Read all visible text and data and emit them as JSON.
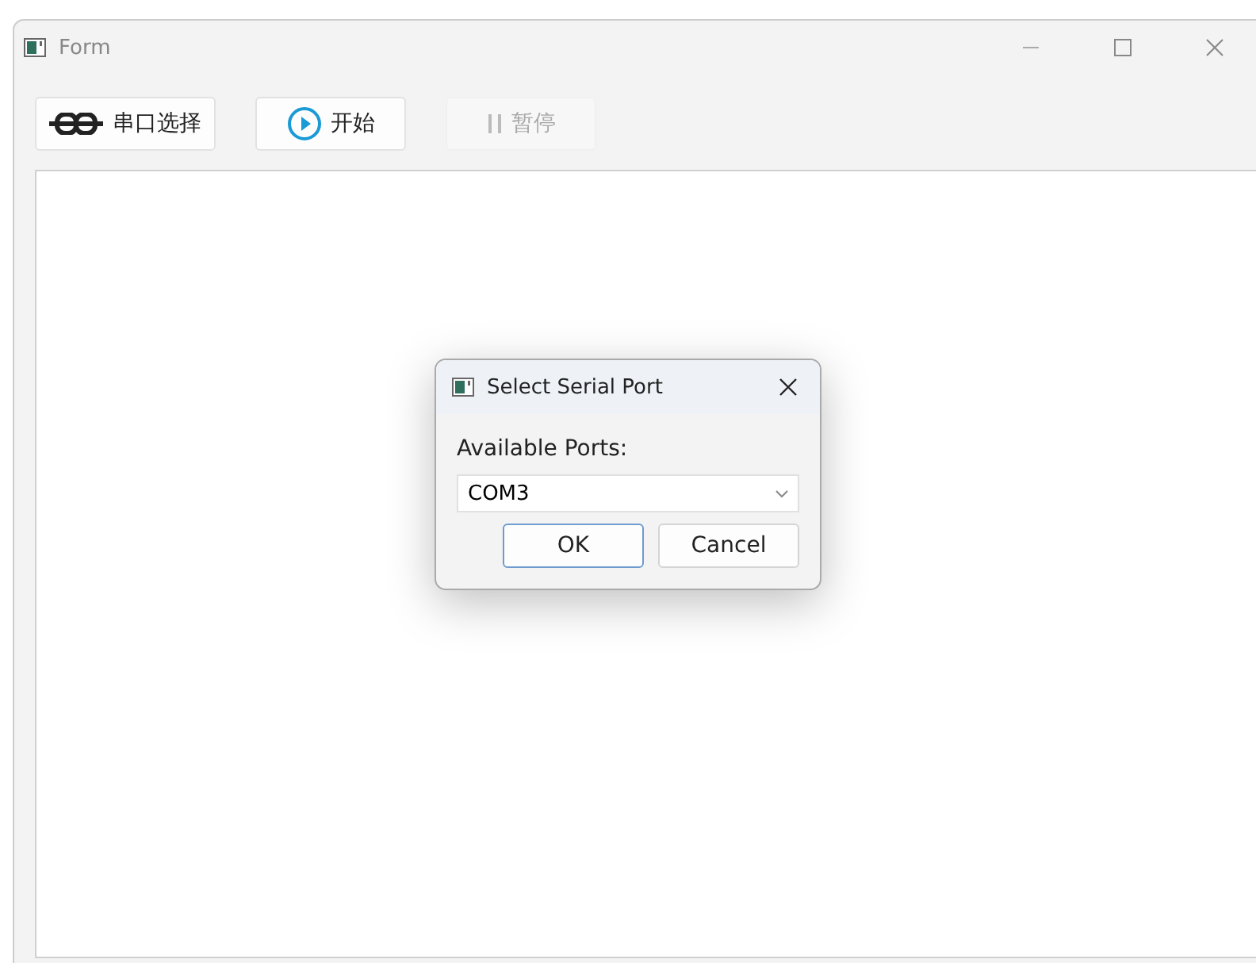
{
  "window": {
    "title": "Form"
  },
  "toolbar": [
    {
      "kind": "chain",
      "label": "串口选择",
      "disabled": false
    },
    {
      "kind": "play",
      "label": "开始",
      "disabled": false
    },
    {
      "kind": "pause",
      "label": "暂停",
      "disabled": true
    }
  ],
  "dialog": {
    "title": "Select Serial Port",
    "label": "Available Ports:",
    "port": "COM3",
    "buttons": [
      {
        "label": "OK",
        "default": true
      },
      {
        "label": "Cancel",
        "default": false
      }
    ]
  }
}
